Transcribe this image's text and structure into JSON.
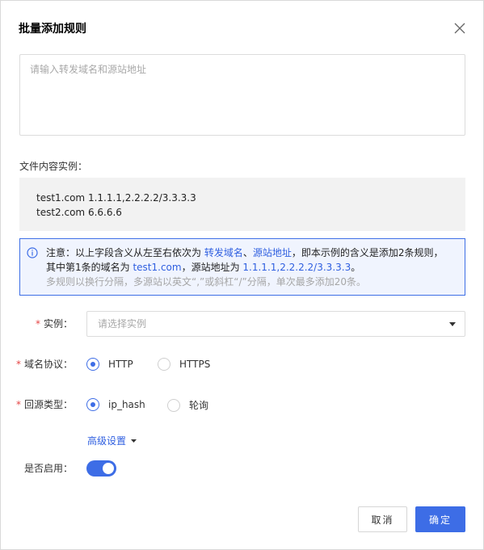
{
  "dialog": {
    "title": "批量添加规则",
    "textarea_placeholder": "请输入转发域名和源站地址",
    "example_label": "文件内容实例：",
    "example_lines": [
      "test1.com 1.1.1.1,2.2.2.2/3.3.3.3",
      "test2.com 6.6.6.6"
    ]
  },
  "notice": {
    "p1": "注意：以上字段含义从左至右依次为 ",
    "link1": "转发域名",
    "sep": "、",
    "link2": "源站地址",
    "p2": "，即本示例的含义是添加2条规则，",
    "p3": "其中第1条的域名为 ",
    "link3": "test1.com",
    "p4": "，源站地址为 ",
    "link4": "1.1.1.1,2.2.2.2/3.3.3.3",
    "p5": "。",
    "muted": "多规则以换行分隔，多源站以英文“,”或斜杠“/”分隔，单次最多添加20条。"
  },
  "form": {
    "instance_label": "实例：",
    "instance_placeholder": "请选择实例",
    "protocol_label": "域名协议：",
    "protocol_options": [
      "HTTP",
      "HTTPS"
    ],
    "protocol_selected": "HTTP",
    "origin_label": "回源类型：",
    "origin_options": [
      "ip_hash",
      "轮询"
    ],
    "origin_selected": "ip_hash",
    "advanced_label": "高级设置",
    "enable_label": "是否启用：",
    "enabled": true,
    "required_mark": "*"
  },
  "buttons": {
    "cancel": "取消",
    "ok": "确定"
  },
  "colors": {
    "primary": "#3d6de6",
    "required": "#e54545",
    "link": "#2f5fe0"
  }
}
